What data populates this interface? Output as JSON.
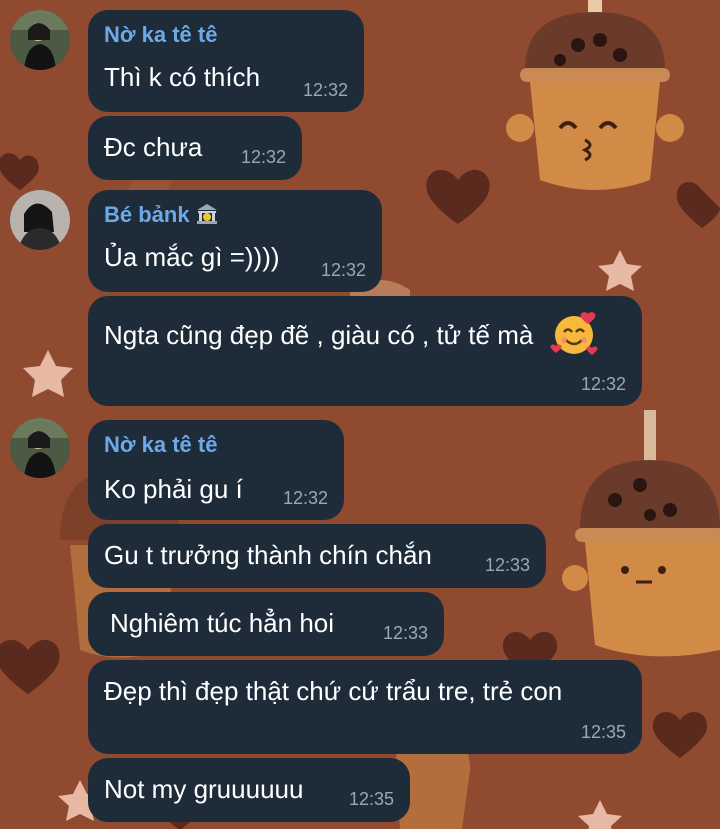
{
  "chat": {
    "messages": [
      {
        "sender": "Nờ ka tê tê",
        "text": "Thì k có thích",
        "time": "12:32"
      },
      {
        "text": "Đc chưa",
        "time": "12:32"
      },
      {
        "sender": "Bé bảnk",
        "sender_icon": "bank-icon",
        "text": "Ủa mắc gì =))))",
        "time": "12:32"
      },
      {
        "text": "Ngta cũng đẹp đẽ , giàu có , tử tế mà",
        "emoji": "smiling-face-with-hearts-icon",
        "time": "12:32"
      },
      {
        "sender": "Nờ ka tê tê",
        "text": "Ko phải gu í",
        "time": "12:32"
      },
      {
        "text": "Gu t trưởng thành chín chắn",
        "time": "12:33"
      },
      {
        "text": "Nghiêm túc hẳn hoi",
        "time": "12:33"
      },
      {
        "text": "Đẹp thì đẹp thật chứ cứ trẩu tre, trẻ con",
        "time": "12:35"
      },
      {
        "text": "Not my gruuuuuu",
        "time": "12:35"
      }
    ]
  },
  "colors": {
    "bubble": "#1e2c3a",
    "sender_name": "#6ea9e6",
    "timestamp": "#9aa7b4",
    "wallpaper": "#8f4a2f"
  }
}
